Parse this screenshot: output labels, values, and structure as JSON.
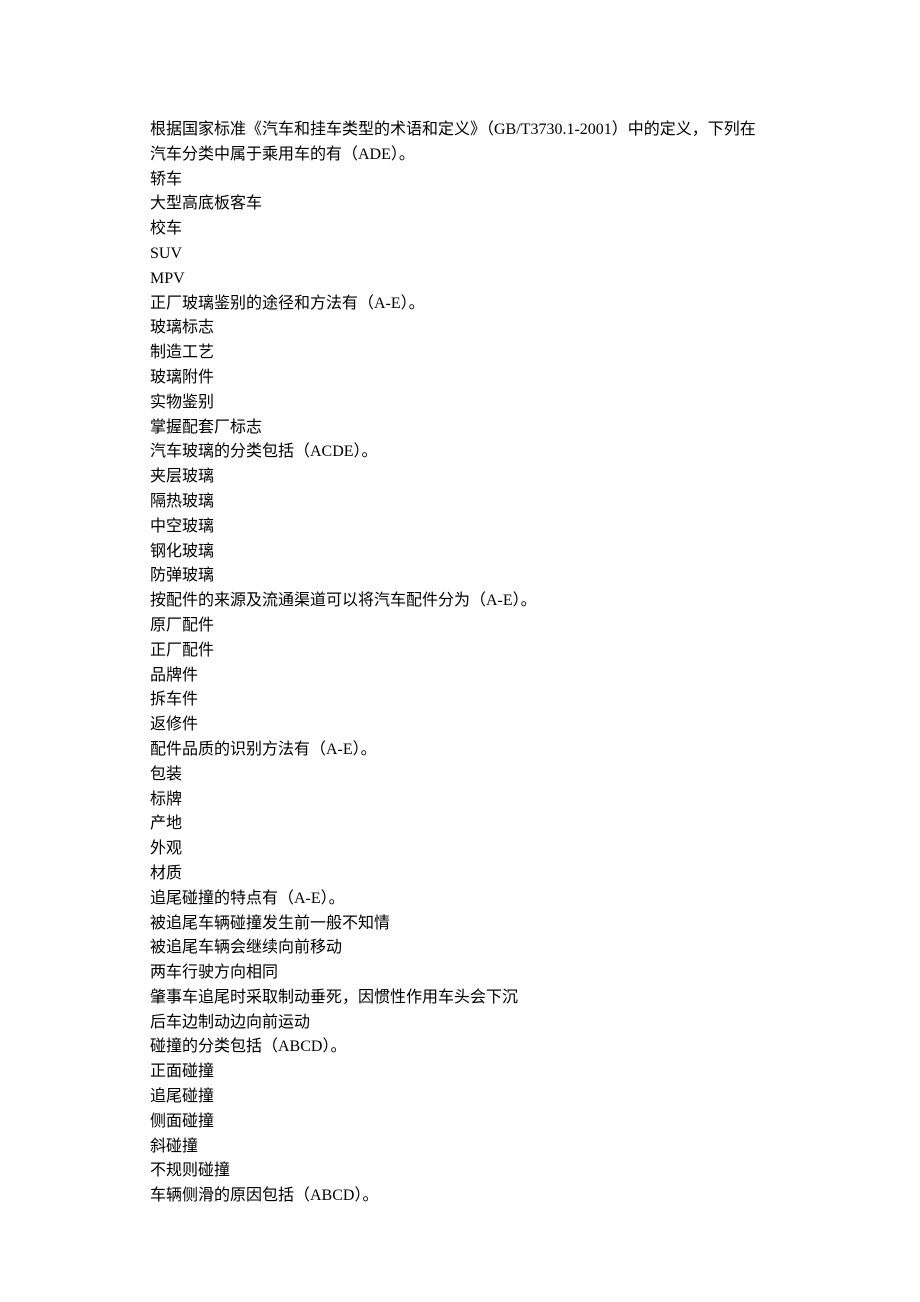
{
  "questions": [
    {
      "prompt": "根据国家标准《汽车和挂车类型的术语和定义》（GB/T3730.1-2001）中的定义，下列在汽车分类中属于乘用车的有（ADE）。",
      "options": [
        "轿车",
        "大型高底板客车",
        "校车",
        "SUV",
        "MPV"
      ]
    },
    {
      "prompt": "正厂玻璃鉴别的途径和方法有（A-E）。",
      "options": [
        "玻璃标志",
        "制造工艺",
        "玻璃附件",
        "实物鉴别",
        "掌握配套厂标志"
      ]
    },
    {
      "prompt": "汽车玻璃的分类包括（ACDE）。",
      "options": [
        "夹层玻璃",
        "隔热玻璃",
        "中空玻璃",
        "钢化玻璃",
        "防弹玻璃"
      ]
    },
    {
      "prompt": "按配件的来源及流通渠道可以将汽车配件分为（A-E）。",
      "options": [
        "原厂配件",
        "正厂配件",
        "品牌件",
        "拆车件",
        "返修件"
      ]
    },
    {
      "prompt": "配件品质的识别方法有（A-E）。",
      "options": [
        "包装",
        "标牌",
        "产地",
        "外观",
        "材质"
      ]
    },
    {
      "prompt": "追尾碰撞的特点有（A-E）。",
      "options": [
        "被追尾车辆碰撞发生前一般不知情",
        "被追尾车辆会继续向前移动",
        "两车行驶方向相同",
        "肇事车追尾时采取制动垂死，因惯性作用车头会下沉",
        "后车边制动边向前运动"
      ]
    },
    {
      "prompt": "碰撞的分类包括（ABCD）。",
      "options": [
        "正面碰撞",
        "追尾碰撞",
        "侧面碰撞",
        "斜碰撞",
        "不规则碰撞"
      ]
    },
    {
      "prompt": "车辆侧滑的原因包括（ABCD）。",
      "options": []
    }
  ]
}
